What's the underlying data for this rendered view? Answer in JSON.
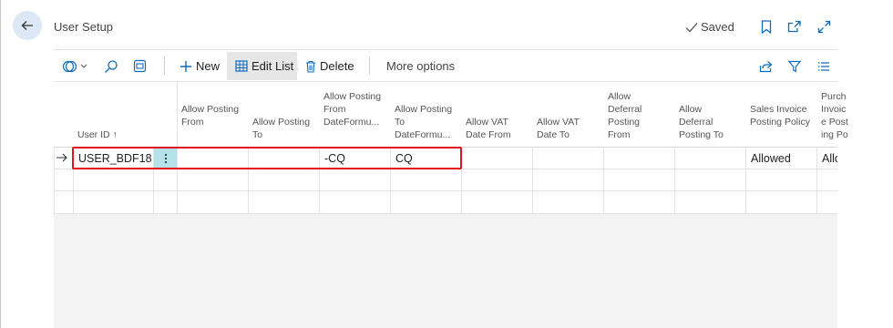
{
  "header": {
    "title": "User Setup",
    "saved_label": "Saved"
  },
  "toolbar": {
    "new_label": "New",
    "edit_list_label": "Edit List",
    "delete_label": "Delete",
    "more_options_label": "More options"
  },
  "columns": [
    {
      "key": "user_id",
      "label": "User ID",
      "sort_indicator": "↑"
    },
    {
      "key": "allow_posting_from",
      "label": "Allow Posting From"
    },
    {
      "key": "allow_posting_to",
      "label": "Allow Posting To"
    },
    {
      "key": "allow_posting_from_dateformula",
      "label": "Allow Posting From DateFormu..."
    },
    {
      "key": "allow_posting_to_dateformula",
      "label": "Allow Posting To DateFormu..."
    },
    {
      "key": "allow_vat_date_from",
      "label": "Allow VAT Date From"
    },
    {
      "key": "allow_vat_date_to",
      "label": "Allow VAT Date To"
    },
    {
      "key": "allow_deferral_posting_from",
      "label": "Allow Deferral Posting From"
    },
    {
      "key": "allow_deferral_posting_to",
      "label": "Allow Deferral Posting To"
    },
    {
      "key": "sales_invoice_posting_policy",
      "label": "Sales Invoice Posting Policy"
    },
    {
      "key": "purch_invoice_posting_policy",
      "label": "Purch Invoice Posting Policy"
    }
  ],
  "rows": [
    {
      "user_id": "USER_BDF18...",
      "allow_posting_from": "",
      "allow_posting_to": "",
      "allow_posting_from_dateformula": "-CQ",
      "allow_posting_to_dateformula": "CQ",
      "allow_vat_date_from": "",
      "allow_vat_date_to": "",
      "allow_deferral_posting_from": "",
      "allow_deferral_posting_to": "",
      "sales_invoice_posting_policy": "Allowed",
      "purch_invoice_posting_policy": "Allowed"
    }
  ],
  "colors": {
    "accent": "#0f6cbd",
    "highlight": "#e3141b",
    "selected_cell": "#b3e2ea"
  }
}
